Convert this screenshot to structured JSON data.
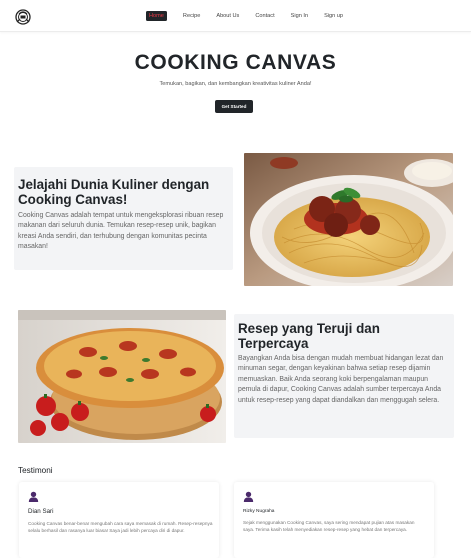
{
  "nav": {
    "links": [
      {
        "label": "Home",
        "active": true
      },
      {
        "label": "Recipe",
        "active": false
      },
      {
        "label": "About Us",
        "active": false
      },
      {
        "label": "Contact",
        "active": false
      },
      {
        "label": "Sign In",
        "active": false
      },
      {
        "label": "Sign up",
        "active": false
      }
    ],
    "logo_icon": "chef-hat-icon"
  },
  "hero": {
    "title": "COOKING CANVAS",
    "subtitle": "Temukan, bagikan, dan kembangkan kreativitas kuliner Anda!",
    "cta": "Get Started"
  },
  "section1": {
    "heading": "Jelajahi Dunia Kuliner dengan Cooking Canvas!",
    "body": "Cooking Canvas adalah tempat untuk mengeksplorasi ribuan resep makanan dari seluruh dunia. Temukan resep-resep unik, bagikan kreasi Anda sendiri, dan terhubung dengan komunitas pecinta masakan!",
    "image": "spaghetti-meatballs-photo"
  },
  "section2": {
    "heading": "Resep yang Teruji dan Terpercaya",
    "body": "Bayangkan Anda bisa dengan mudah membuat hidangan lezat dan minuman segar, dengan keyakinan bahwa setiap resep dijamin memuaskan. Baik Anda seorang koki berpengalaman maupun pemula di dapur, Cooking Canvas adalah sumber terpercaya Anda untuk resep-resep yang dapat diandalkan dan menggugah selera.",
    "image": "pizza-tomatoes-photo"
  },
  "testimonials": {
    "heading": "Testimoni",
    "items": [
      {
        "name": "Dian Sari",
        "text": "Cooking Canvas benar-benar mengubah cara saya memasak di rumah. Resep-resepnya selalu berhasil dan rasanya luar biasa! Saya jadi lebih percaya diri di dapur."
      },
      {
        "name": "Rizky Nugraha",
        "text": "Sejak menggunakan Cooking Canvas, saya sering mendapat pujian atas masakan saya. Terima kasih telah menyediakan resep-resep yang hebat dan terpercaya."
      }
    ]
  },
  "colors": {
    "accent_red": "#e63946",
    "dark": "#212529",
    "avatar_purple": "#4b2a6b",
    "card_bg": "#f3f4f6"
  }
}
